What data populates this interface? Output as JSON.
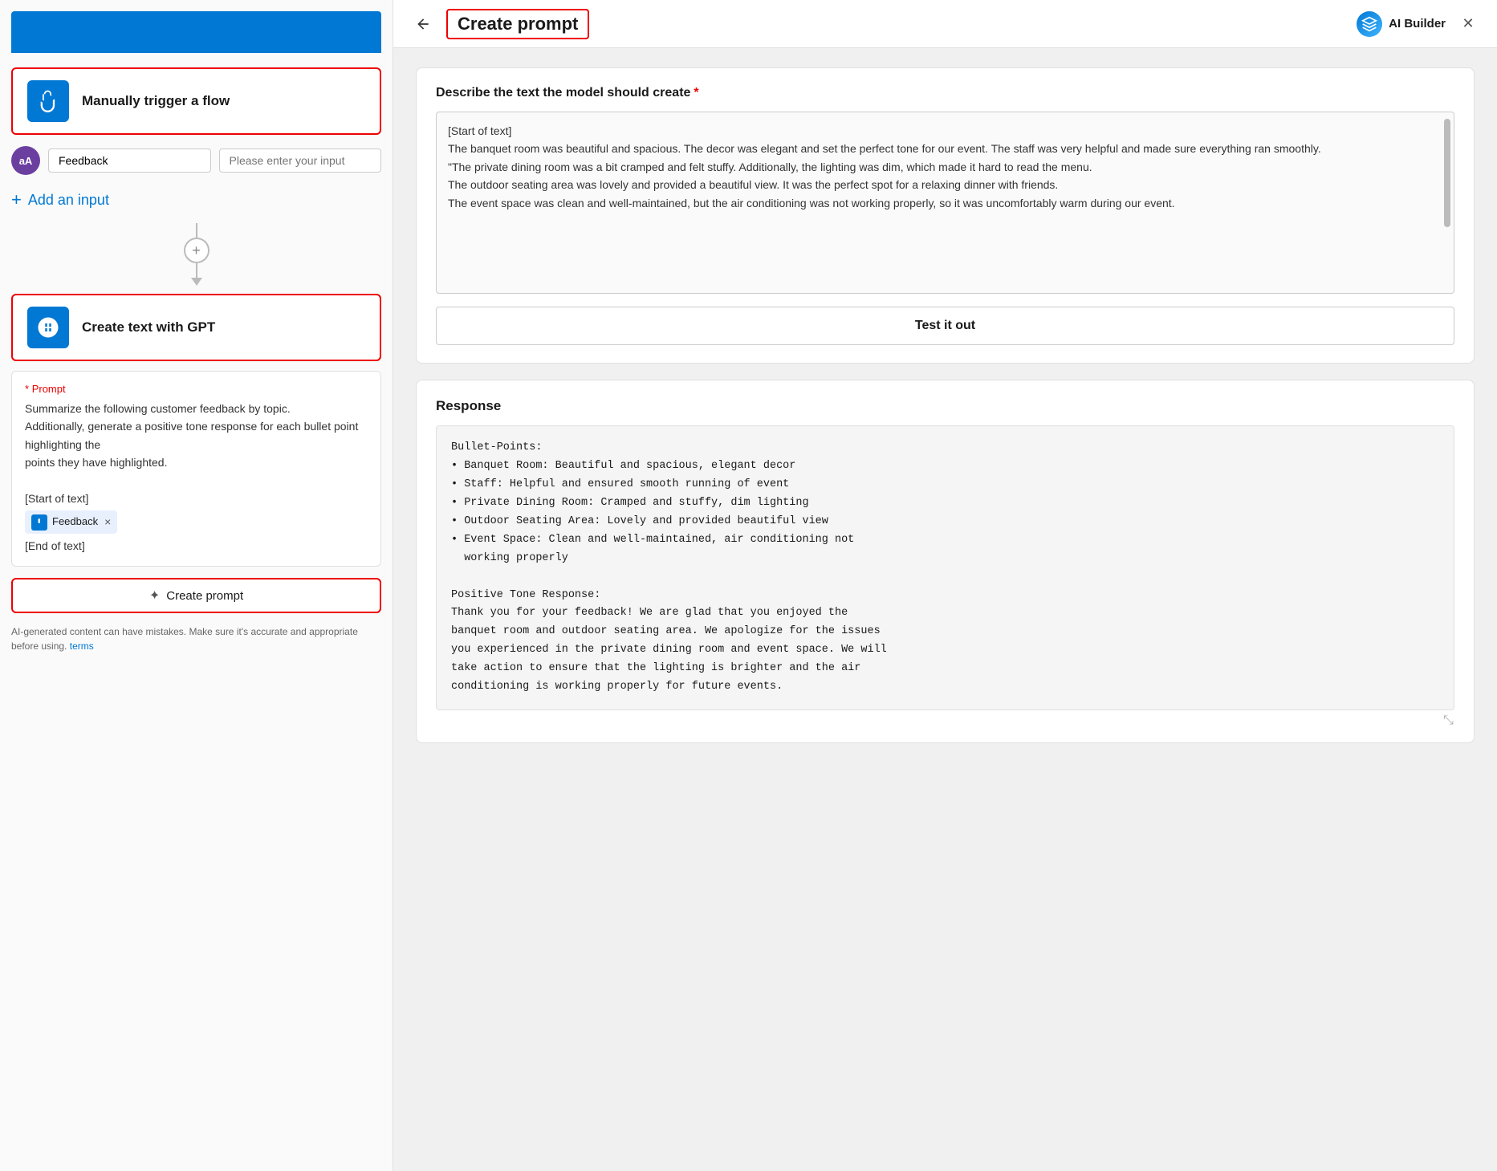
{
  "left": {
    "trigger": {
      "label": "Manually trigger a flow"
    },
    "input_row": {
      "avatar_initials": "aA",
      "field_label": "Feedback",
      "field_placeholder": "Please enter your input"
    },
    "add_input": {
      "label": "Add an input"
    },
    "gpt": {
      "label": "Create text with GPT"
    },
    "prompt": {
      "asterisk": "*",
      "label": "Prompt",
      "line1": "Summarize the following customer feedback by topic.",
      "line2": "Additionally, generate a positive tone response for each bullet point highlighting the",
      "line3": "points they have highlighted.",
      "start_tag": "[Start of text]",
      "feedback_tag": "Feedback",
      "end_tag": "[End of text]"
    },
    "create_prompt_btn": "Create prompt",
    "ai_notice": "AI-generated content can have mistakes. Make sure it's accurate and appropriate before using.",
    "ai_notice_link": "terms"
  },
  "right": {
    "header": {
      "title": "Create prompt",
      "ai_builder_label": "AI Builder",
      "close_label": "✕"
    },
    "describe_section": {
      "title": "Describe the text the model should create",
      "required_marker": "*",
      "textarea_content": "[Start of text]\nThe banquet room was beautiful and spacious. The decor was elegant and set the perfect tone for our event. The staff was very helpful and made sure everything ran smoothly.\n\"The private dining room was a bit cramped and felt stuffy. Additionally, the lighting was dim, which made it hard to read the menu.\nThe outdoor seating area was lovely and provided a beautiful view. It was the perfect spot for a relaxing dinner with friends.\nThe event space was clean and well-maintained, but the air conditioning was not working properly, so it was uncomfortably warm during our event."
    },
    "test_btn_label": "Test it out",
    "response_section": {
      "title": "Response",
      "content": "Bullet-Points:\n• Banquet Room: Beautiful and spacious, elegant decor\n• Staff: Helpful and ensured smooth running of event\n• Private Dining Room: Cramped and stuffy, dim lighting\n• Outdoor Seating Area: Lovely and provided beautiful view\n• Event Space: Clean and well-maintained, air conditioning not\n  working properly\n\nPositive Tone Response:\nThank you for your feedback! We are glad that you enjoyed the\nbanquet room and outdoor seating area. We apologize for the issues\nyou experienced in the private dining room and event space. We will\ntake action to ensure that the lighting is brighter and the air\nconditioning is working properly for future events."
    }
  }
}
